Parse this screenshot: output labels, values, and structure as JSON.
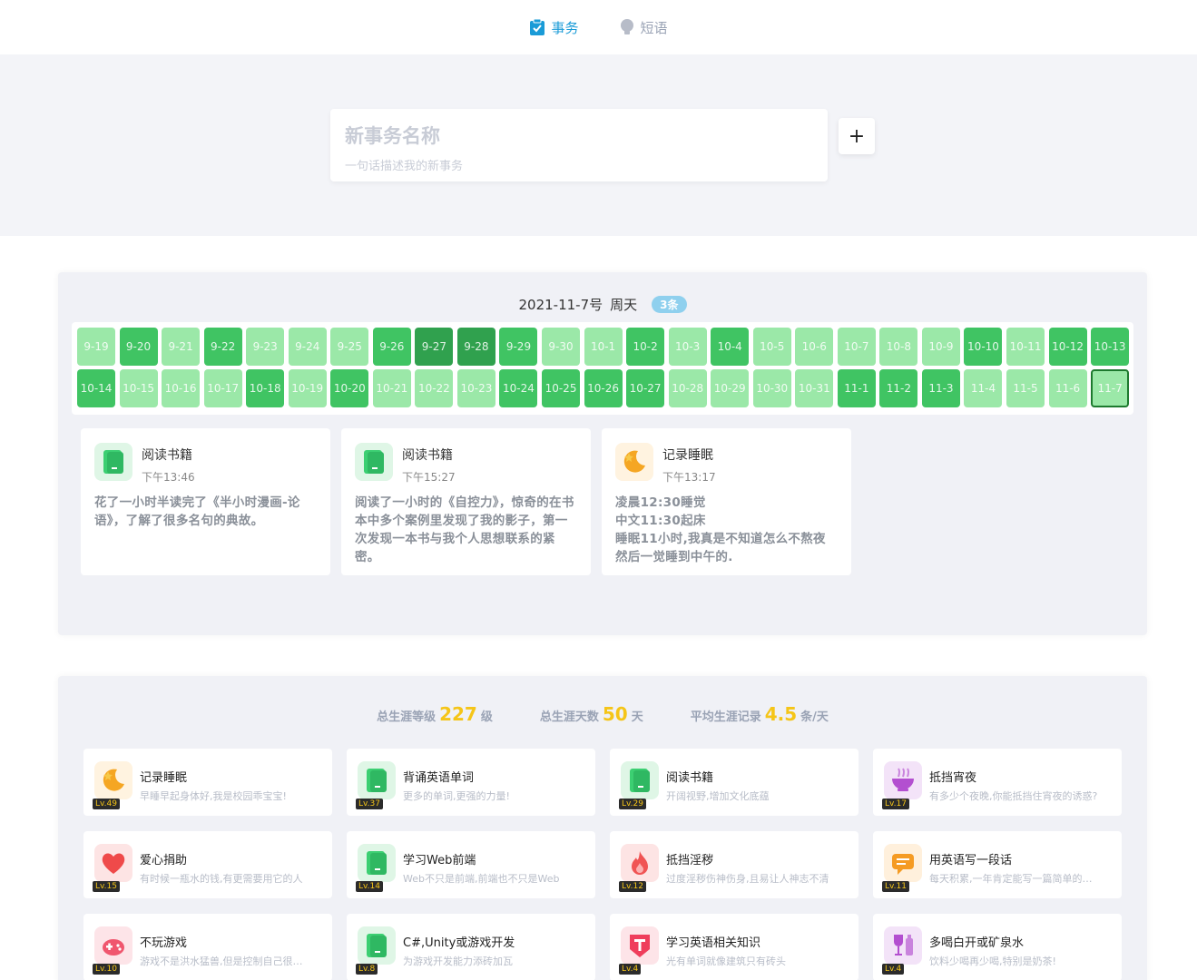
{
  "nav": {
    "tabs": [
      {
        "label": "事务",
        "icon": "clipboard-check-icon",
        "active": true
      },
      {
        "label": "短语",
        "icon": "lightbulb-icon",
        "active": false
      }
    ]
  },
  "new_task": {
    "title_placeholder": "新事务名称",
    "desc_placeholder": "一句话描述我的新事务",
    "add_label": "+"
  },
  "calendar": {
    "date": "2021-11-7号",
    "weekday": "周天",
    "count": "3条",
    "days": [
      {
        "label": "9-19",
        "level": 1
      },
      {
        "label": "9-20",
        "level": 2
      },
      {
        "label": "9-21",
        "level": 1
      },
      {
        "label": "9-22",
        "level": 2
      },
      {
        "label": "9-23",
        "level": 1
      },
      {
        "label": "9-24",
        "level": 1
      },
      {
        "label": "9-25",
        "level": 1
      },
      {
        "label": "9-26",
        "level": 2
      },
      {
        "label": "9-27",
        "level": 3
      },
      {
        "label": "9-28",
        "level": 3
      },
      {
        "label": "9-29",
        "level": 2
      },
      {
        "label": "9-30",
        "level": 1
      },
      {
        "label": "10-1",
        "level": 1
      },
      {
        "label": "10-2",
        "level": 2
      },
      {
        "label": "10-3",
        "level": 1
      },
      {
        "label": "10-4",
        "level": 2
      },
      {
        "label": "10-5",
        "level": 1
      },
      {
        "label": "10-6",
        "level": 1
      },
      {
        "label": "10-7",
        "level": 1
      },
      {
        "label": "10-8",
        "level": 1
      },
      {
        "label": "10-9",
        "level": 1
      },
      {
        "label": "10-10",
        "level": 2
      },
      {
        "label": "10-11",
        "level": 1
      },
      {
        "label": "10-12",
        "level": 2
      },
      {
        "label": "10-13",
        "level": 2
      },
      {
        "label": "10-14",
        "level": 2
      },
      {
        "label": "10-15",
        "level": 1
      },
      {
        "label": "10-16",
        "level": 1
      },
      {
        "label": "10-17",
        "level": 1
      },
      {
        "label": "10-18",
        "level": 2
      },
      {
        "label": "10-19",
        "level": 1
      },
      {
        "label": "10-20",
        "level": 2
      },
      {
        "label": "10-21",
        "level": 1
      },
      {
        "label": "10-22",
        "level": 1
      },
      {
        "label": "10-23",
        "level": 1
      },
      {
        "label": "10-24",
        "level": 2
      },
      {
        "label": "10-25",
        "level": 2
      },
      {
        "label": "10-26",
        "level": 2
      },
      {
        "label": "10-27",
        "level": 2
      },
      {
        "label": "10-28",
        "level": 1
      },
      {
        "label": "10-29",
        "level": 1
      },
      {
        "label": "10-30",
        "level": 1
      },
      {
        "label": "10-31",
        "level": 1
      },
      {
        "label": "11-1",
        "level": 2
      },
      {
        "label": "11-2",
        "level": 2
      },
      {
        "label": "11-3",
        "level": 2
      },
      {
        "label": "11-4",
        "level": 1
      },
      {
        "label": "11-5",
        "level": 1
      },
      {
        "label": "11-6",
        "level": 1
      },
      {
        "label": "11-7",
        "level": 1,
        "selected": true
      }
    ],
    "colors": {
      "level1": "#9be8a8",
      "level2": "#40c463",
      "level3": "#30a14e"
    }
  },
  "entries": [
    {
      "name": "阅读书籍",
      "time": "下午13:46",
      "icon": "green-book-icon",
      "text": "花了一小时半读完了《半小时漫画-论语》，了解了很多名句的典故。"
    },
    {
      "name": "阅读书籍",
      "time": "下午15:27",
      "icon": "green-book-icon",
      "text": "阅读了一小时的《自控力》，惊奇的在书本中多个案例里发现了我的影子，第一次发现一本书与我个人思想联系的紧密。"
    },
    {
      "name": "记录睡眠",
      "time": "下午13:17",
      "icon": "moon-icon",
      "text_lines": [
        "凌晨12:30睡觉",
        "中文11:30起床",
        "睡眠11小时,我真是不知道怎么不熬夜然后一觉睡到中午的."
      ]
    }
  ],
  "stats": {
    "level_label": "总生涯等级",
    "level_value": "227",
    "level_unit": "级",
    "days_label": "总生涯天数",
    "days_value": "50",
    "days_unit": "天",
    "avg_label": "平均生涯记录",
    "avg_value": "4.5",
    "avg_unit": "条/天"
  },
  "habits": [
    {
      "name": "记录睡眠",
      "desc": "早睡早起身体好,我是校园乖宝宝!",
      "level": "Lv.49",
      "icon": "moon-icon"
    },
    {
      "name": "背诵英语单词",
      "desc": "更多的单词,更强的力量!",
      "level": "Lv.37",
      "icon": "green-book-icon"
    },
    {
      "name": "阅读书籍",
      "desc": "开阔视野,增加文化底蕴",
      "level": "Lv.29",
      "icon": "green-book-icon"
    },
    {
      "name": "抵挡宵夜",
      "desc": "有多少个夜晚,你能抵挡住宵夜的诱惑?",
      "level": "Lv.17",
      "icon": "noodle-bowl-icon"
    },
    {
      "name": "爱心捐助",
      "desc": "有时候一瓶水的钱,有更需要用它的人",
      "level": "Lv.15",
      "icon": "heart-icon"
    },
    {
      "name": "学习Web前端",
      "desc": "Web不只是前端,前端也不只是Web",
      "level": "Lv.14",
      "icon": "green-book-icon"
    },
    {
      "name": "抵挡淫秽",
      "desc": "过度淫秽伤神伤身,且易让人神志不清",
      "level": "Lv.12",
      "icon": "fire-icon"
    },
    {
      "name": "用英语写一段话",
      "desc": "每天积累,一年肯定能写一篇简单的文章",
      "level": "Lv.11",
      "icon": "chat-bubble-icon"
    },
    {
      "name": "不玩游戏",
      "desc": "游戏不是洪水猛兽,但是控制自己很重要",
      "level": "Lv.10",
      "icon": "gamepad-icon"
    },
    {
      "name": "C#,Unity或游戏开发",
      "desc": "为游戏开发能力添砖加瓦",
      "level": "Lv.8",
      "icon": "green-book-icon"
    },
    {
      "name": "学习英语相关知识",
      "desc": "光有单词就像建筑只有砖头",
      "level": "Lv.4",
      "icon": "t-shield-icon"
    },
    {
      "name": "多喝白开或矿泉水",
      "desc": "饮料少喝再少喝,特别是奶茶!",
      "level": "Lv.4",
      "icon": "wine-glass-icon"
    }
  ]
}
